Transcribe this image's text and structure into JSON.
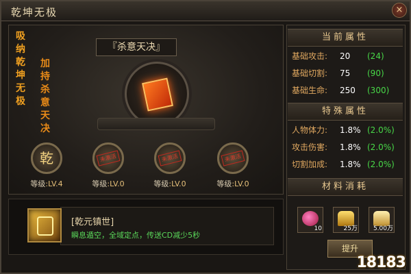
{
  "window": {
    "title": "乾坤无极",
    "close_glyph": "×"
  },
  "side_labels": {
    "left": "吸纳乾坤无极",
    "right": "加持杀意天决"
  },
  "skill": {
    "name": "『杀意天决』"
  },
  "sub_skills": [
    {
      "glyph": "乾",
      "locked": false,
      "level_label": "等级",
      "level_value": ":LV.4"
    },
    {
      "glyph": "",
      "locked": true,
      "stamp": "未激活",
      "level_label": "等级",
      "level_value": ":LV.0"
    },
    {
      "glyph": "",
      "locked": true,
      "stamp": "未激活",
      "level_label": "等级",
      "level_value": ":LV.0"
    },
    {
      "glyph": "",
      "locked": true,
      "stamp": "未激活",
      "level_label": "等级",
      "level_value": ":LV.0"
    }
  ],
  "effect": {
    "title": "[乾元镇世]",
    "description": "瞬息遁空，全域定点，传送CD减少5秒"
  },
  "current_attrs": {
    "header": "当前属性",
    "rows": [
      {
        "label": "基础攻击:",
        "value": "20",
        "bonus": "(24)"
      },
      {
        "label": "基础切割:",
        "value": "75",
        "bonus": "(90)"
      },
      {
        "label": "基础生命:",
        "value": "250",
        "bonus": "(300)"
      }
    ]
  },
  "special_attrs": {
    "header": "特殊属性",
    "rows": [
      {
        "label": "人物体力:",
        "value": "1.8%",
        "bonus": "(2.0%)"
      },
      {
        "label": "攻击伤害:",
        "value": "1.8%",
        "bonus": "(2.0%)"
      },
      {
        "label": "切割加成:",
        "value": "1.8%",
        "bonus": "(2.0%)"
      }
    ]
  },
  "materials": {
    "header": "材料消耗",
    "items": [
      {
        "icon": "red-orb-icon",
        "count": "10"
      },
      {
        "icon": "gold-ingot-icon",
        "count": "25万"
      },
      {
        "icon": "silver-ingot-icon",
        "count": "5.00万"
      }
    ]
  },
  "action_button": {
    "label": "提升"
  },
  "watermark": "18183",
  "colors": {
    "orange": "#f0a020",
    "green": "#48d848",
    "gold": "#e8c890"
  }
}
